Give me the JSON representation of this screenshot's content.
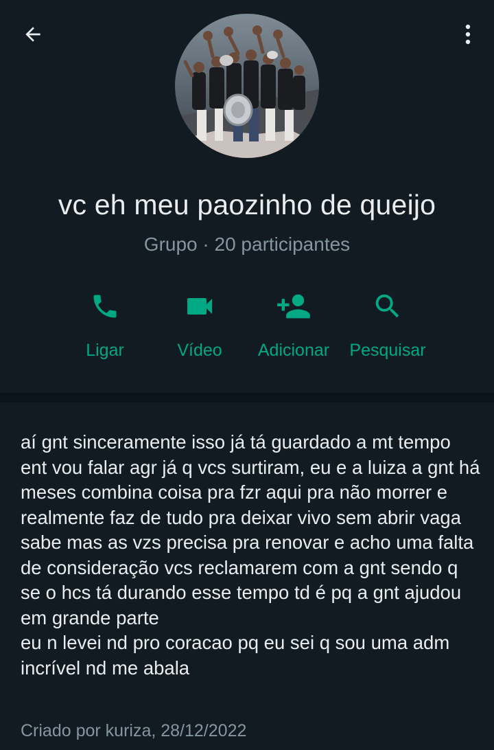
{
  "header": {
    "group_name": "vc eh meu paozinho de queijo",
    "group_meta": "Grupo · 20 participantes"
  },
  "actions": [
    {
      "label": "Ligar",
      "icon": "phone-icon"
    },
    {
      "label": "Vídeo",
      "icon": "video-camera-icon"
    },
    {
      "label": "Adicionar",
      "icon": "add-person-icon"
    },
    {
      "label": "Pesquisar",
      "icon": "search-icon"
    }
  ],
  "description": {
    "text": "aí gnt sinceramente isso já tá guardado a mt tempo ent vou falar agr já q vcs surtiram, eu e a luiza a gnt há meses combina coisa pra fzr aqui pra não morrer e realmente faz de tudo pra deixar vivo sem abrir vaga sabe mas as vzs precisa pra renovar e acho uma falta de consideração vcs reclamarem com a gnt sendo q se o hcs tá durando esse tempo td é pq a gnt ajudou em grande parte\neu n levei nd pro coracao pq eu sei q sou uma adm incrível nd me abala",
    "created_by": "Criado por kuriza, 28/12/2022"
  },
  "colors": {
    "background": "#0b141a",
    "panel": "#111b21",
    "accent": "#00a884",
    "primary_text": "#e9edef",
    "secondary_text": "#8696a0"
  }
}
